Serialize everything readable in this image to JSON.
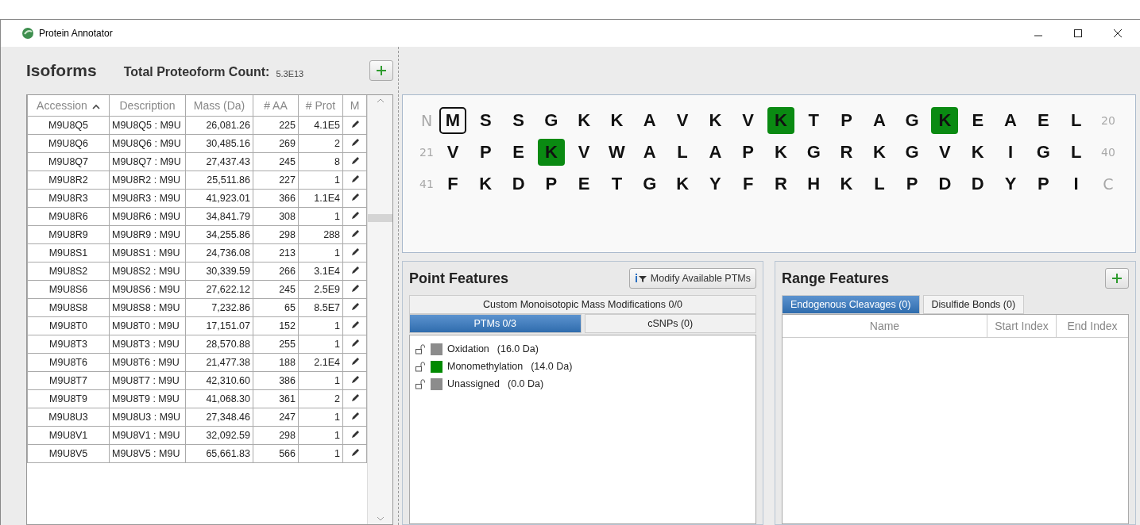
{
  "window": {
    "title": "Protein Annotator"
  },
  "isoforms": {
    "title": "Isoforms",
    "count_label": "Total Proteoform Count:",
    "count_value": "5.3E13",
    "columns": [
      {
        "label": "Accession",
        "sorted": true
      },
      {
        "label": "Description",
        "sorted": false
      },
      {
        "label": "Mass (Da)",
        "sorted": false
      },
      {
        "label": "# AA",
        "sorted": false
      },
      {
        "label": "# Prot",
        "sorted": false
      },
      {
        "label": "M",
        "sorted": false
      }
    ],
    "rows": [
      {
        "accession": "M9U8Q5",
        "description": "M9U8Q5 : M9U",
        "mass": "26,081.26",
        "aa": "225",
        "prot": "4.1E5"
      },
      {
        "accession": "M9U8Q6",
        "description": "M9U8Q6 : M9U",
        "mass": "30,485.16",
        "aa": "269",
        "prot": "2"
      },
      {
        "accession": "M9U8Q7",
        "description": "M9U8Q7 : M9U",
        "mass": "27,437.43",
        "aa": "245",
        "prot": "8"
      },
      {
        "accession": "M9U8R2",
        "description": "M9U8R2 : M9U",
        "mass": "25,511.86",
        "aa": "227",
        "prot": "1"
      },
      {
        "accession": "M9U8R3",
        "description": "M9U8R3 : M9U",
        "mass": "41,923.01",
        "aa": "366",
        "prot": "1.1E4"
      },
      {
        "accession": "M9U8R6",
        "description": "M9U8R6 : M9U",
        "mass": "34,841.79",
        "aa": "308",
        "prot": "1"
      },
      {
        "accession": "M9U8R9",
        "description": "M9U8R9 : M9U",
        "mass": "34,255.86",
        "aa": "298",
        "prot": "288"
      },
      {
        "accession": "M9U8S1",
        "description": "M9U8S1 : M9U",
        "mass": "24,736.08",
        "aa": "213",
        "prot": "1"
      },
      {
        "accession": "M9U8S2",
        "description": "M9U8S2 : M9U",
        "mass": "30,339.59",
        "aa": "266",
        "prot": "3.1E4"
      },
      {
        "accession": "M9U8S6",
        "description": "M9U8S6 : M9U",
        "mass": "27,622.12",
        "aa": "245",
        "prot": "2.5E9"
      },
      {
        "accession": "M9U8S8",
        "description": "M9U8S8 : M9U",
        "mass": "7,232.86",
        "aa": "65",
        "prot": "8.5E7"
      },
      {
        "accession": "M9U8T0",
        "description": "M9U8T0 : M9U",
        "mass": "17,151.07",
        "aa": "152",
        "prot": "1"
      },
      {
        "accession": "M9U8T3",
        "description": "M9U8T3 : M9U",
        "mass": "28,570.88",
        "aa": "255",
        "prot": "1"
      },
      {
        "accession": "M9U8T6",
        "description": "M9U8T6 : M9U",
        "mass": "21,477.38",
        "aa": "188",
        "prot": "2.1E4"
      },
      {
        "accession": "M9U8T7",
        "description": "M9U8T7 : M9U",
        "mass": "42,310.60",
        "aa": "386",
        "prot": "1"
      },
      {
        "accession": "M9U8T9",
        "description": "M9U8T9 : M9U",
        "mass": "41,068.30",
        "aa": "361",
        "prot": "2"
      },
      {
        "accession": "M9U8U3",
        "description": "M9U8U3 : M9U",
        "mass": "27,348.46",
        "aa": "247",
        "prot": "1"
      },
      {
        "accession": "M9U8V1",
        "description": "M9U8V1 : M9U",
        "mass": "32,092.59",
        "aa": "298",
        "prot": "1"
      },
      {
        "accession": "M9U8V5",
        "description": "M9U8V5 : M9U",
        "mass": "65,661.83",
        "aa": "566",
        "prot": "1"
      }
    ]
  },
  "sequence": {
    "lines": [
      {
        "start": "N",
        "end": "20",
        "residues": [
          {
            "letter": "M",
            "selected": true,
            "modified": false
          },
          {
            "letter": "S",
            "selected": false,
            "modified": false
          },
          {
            "letter": "S",
            "selected": false,
            "modified": false
          },
          {
            "letter": "G",
            "selected": false,
            "modified": false
          },
          {
            "letter": "K",
            "selected": false,
            "modified": false
          },
          {
            "letter": "K",
            "selected": false,
            "modified": false
          },
          {
            "letter": "A",
            "selected": false,
            "modified": false
          },
          {
            "letter": "V",
            "selected": false,
            "modified": false
          },
          {
            "letter": "K",
            "selected": false,
            "modified": false
          },
          {
            "letter": "V",
            "selected": false,
            "modified": false
          },
          {
            "letter": "K",
            "selected": false,
            "modified": true
          },
          {
            "letter": "T",
            "selected": false,
            "modified": false
          },
          {
            "letter": "P",
            "selected": false,
            "modified": false
          },
          {
            "letter": "A",
            "selected": false,
            "modified": false
          },
          {
            "letter": "G",
            "selected": false,
            "modified": false
          },
          {
            "letter": "K",
            "selected": false,
            "modified": true
          },
          {
            "letter": "E",
            "selected": false,
            "modified": false
          },
          {
            "letter": "A",
            "selected": false,
            "modified": false
          },
          {
            "letter": "E",
            "selected": false,
            "modified": false
          },
          {
            "letter": "L",
            "selected": false,
            "modified": false
          }
        ]
      },
      {
        "start": "21",
        "end": "40",
        "residues": [
          {
            "letter": "V",
            "selected": false,
            "modified": false
          },
          {
            "letter": "P",
            "selected": false,
            "modified": false
          },
          {
            "letter": "E",
            "selected": false,
            "modified": false
          },
          {
            "letter": "K",
            "selected": false,
            "modified": true
          },
          {
            "letter": "V",
            "selected": false,
            "modified": false
          },
          {
            "letter": "W",
            "selected": false,
            "modified": false
          },
          {
            "letter": "A",
            "selected": false,
            "modified": false
          },
          {
            "letter": "L",
            "selected": false,
            "modified": false
          },
          {
            "letter": "A",
            "selected": false,
            "modified": false
          },
          {
            "letter": "P",
            "selected": false,
            "modified": false
          },
          {
            "letter": "K",
            "selected": false,
            "modified": false
          },
          {
            "letter": "G",
            "selected": false,
            "modified": false
          },
          {
            "letter": "R",
            "selected": false,
            "modified": false
          },
          {
            "letter": "K",
            "selected": false,
            "modified": false
          },
          {
            "letter": "G",
            "selected": false,
            "modified": false
          },
          {
            "letter": "V",
            "selected": false,
            "modified": false
          },
          {
            "letter": "K",
            "selected": false,
            "modified": false
          },
          {
            "letter": "I",
            "selected": false,
            "modified": false
          },
          {
            "letter": "G",
            "selected": false,
            "modified": false
          },
          {
            "letter": "L",
            "selected": false,
            "modified": false
          }
        ]
      },
      {
        "start": "41",
        "end": "C",
        "residues": [
          {
            "letter": "F",
            "selected": false,
            "modified": false
          },
          {
            "letter": "K",
            "selected": false,
            "modified": false
          },
          {
            "letter": "D",
            "selected": false,
            "modified": false
          },
          {
            "letter": "P",
            "selected": false,
            "modified": false
          },
          {
            "letter": "E",
            "selected": false,
            "modified": false
          },
          {
            "letter": "T",
            "selected": false,
            "modified": false
          },
          {
            "letter": "G",
            "selected": false,
            "modified": false
          },
          {
            "letter": "K",
            "selected": false,
            "modified": false
          },
          {
            "letter": "Y",
            "selected": false,
            "modified": false
          },
          {
            "letter": "F",
            "selected": false,
            "modified": false
          },
          {
            "letter": "R",
            "selected": false,
            "modified": false
          },
          {
            "letter": "H",
            "selected": false,
            "modified": false
          },
          {
            "letter": "K",
            "selected": false,
            "modified": false
          },
          {
            "letter": "L",
            "selected": false,
            "modified": false
          },
          {
            "letter": "P",
            "selected": false,
            "modified": false
          },
          {
            "letter": "D",
            "selected": false,
            "modified": false
          },
          {
            "letter": "D",
            "selected": false,
            "modified": false
          },
          {
            "letter": "Y",
            "selected": false,
            "modified": false
          },
          {
            "letter": "P",
            "selected": false,
            "modified": false
          },
          {
            "letter": "I",
            "selected": false,
            "modified": false
          }
        ]
      }
    ]
  },
  "point_features": {
    "title": "Point Features",
    "modify_button": "Modify Available PTMs",
    "custom_tab": "Custom Monoisotopic Mass Modifications 0/0",
    "tabs": [
      {
        "label": "PTMs 0/3",
        "selected": true
      },
      {
        "label": "cSNPs (0)",
        "selected": false
      }
    ],
    "ptms": [
      {
        "name": "Oxidation",
        "mass": "(16.0 Da)",
        "color": "#8c8c8c"
      },
      {
        "name": "Monomethylation",
        "mass": "(14.0 Da)",
        "color": "#008a00"
      },
      {
        "name": "Unassigned",
        "mass": "(0.0 Da)",
        "color": "#8c8c8c"
      }
    ]
  },
  "range_features": {
    "title": "Range Features",
    "tabs": [
      {
        "label": "Endogenous Cleavages (0)",
        "selected": true
      },
      {
        "label": "Disulfide Bonds (0)",
        "selected": false
      }
    ],
    "columns": [
      "Name",
      "Start Index",
      "End Index"
    ]
  }
}
